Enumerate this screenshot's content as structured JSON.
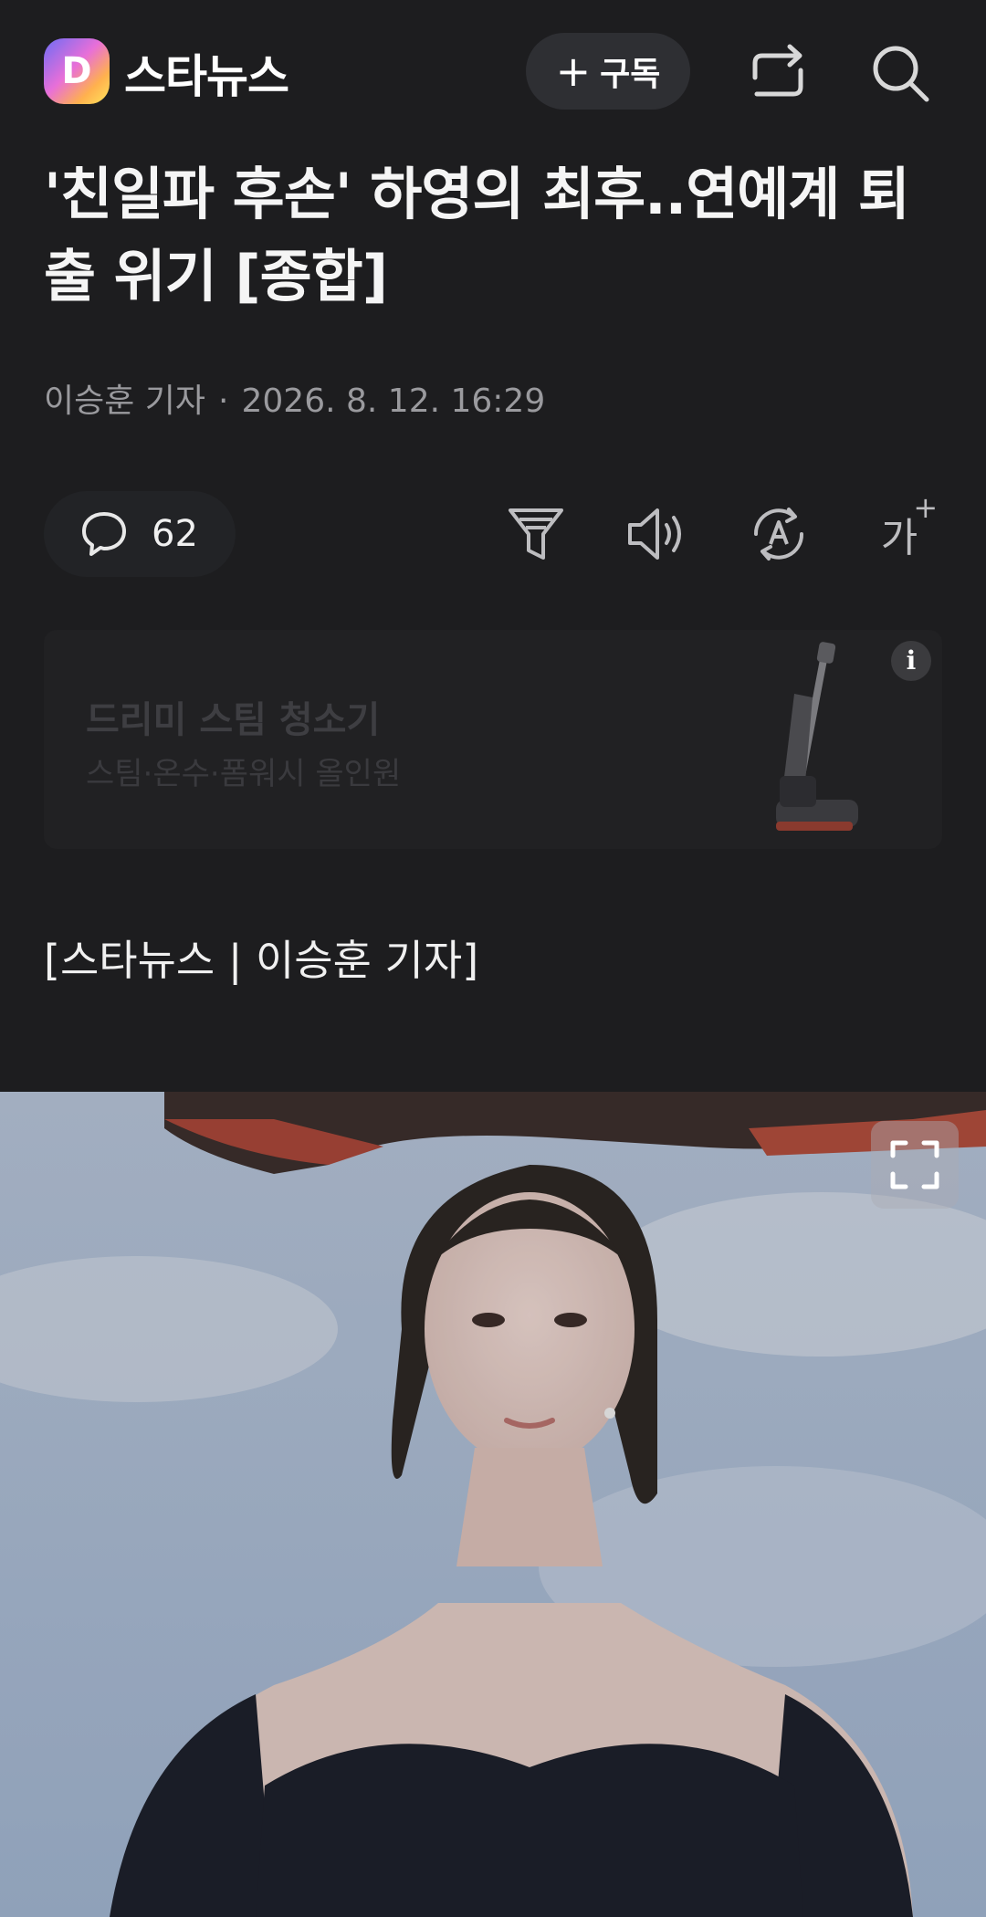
{
  "header": {
    "logo_letter": "D",
    "brand": "스타뉴스",
    "subscribe_plus": "+",
    "subscribe_label": "구독",
    "share_icon": "share-icon",
    "search_icon": "search-icon"
  },
  "article": {
    "title": "'친일파 후손' 하영의 최후..연예계 퇴출 위기 [종합]",
    "author": "이승훈 기자",
    "separator": "·",
    "date": "2026. 8. 12. 16:29",
    "source_line": "[스타뉴스 | 이승훈 기자]"
  },
  "toolbar": {
    "comment_count": "62",
    "font_size_label": "가",
    "font_size_plus": "+",
    "icons": [
      "comment-icon",
      "summary-filter-icon",
      "speaker-icon",
      "translate-icon",
      "font-size-icon"
    ]
  },
  "ad": {
    "title": "드리미 스팀 청소기",
    "subtitle": "스팀·온수·폼워시 올인원",
    "info_label": "i"
  },
  "colors": {
    "background": "#1d1d1f",
    "text": "#f2f2f2",
    "muted": "#9a9a9e",
    "pill": "#2e2f33"
  }
}
